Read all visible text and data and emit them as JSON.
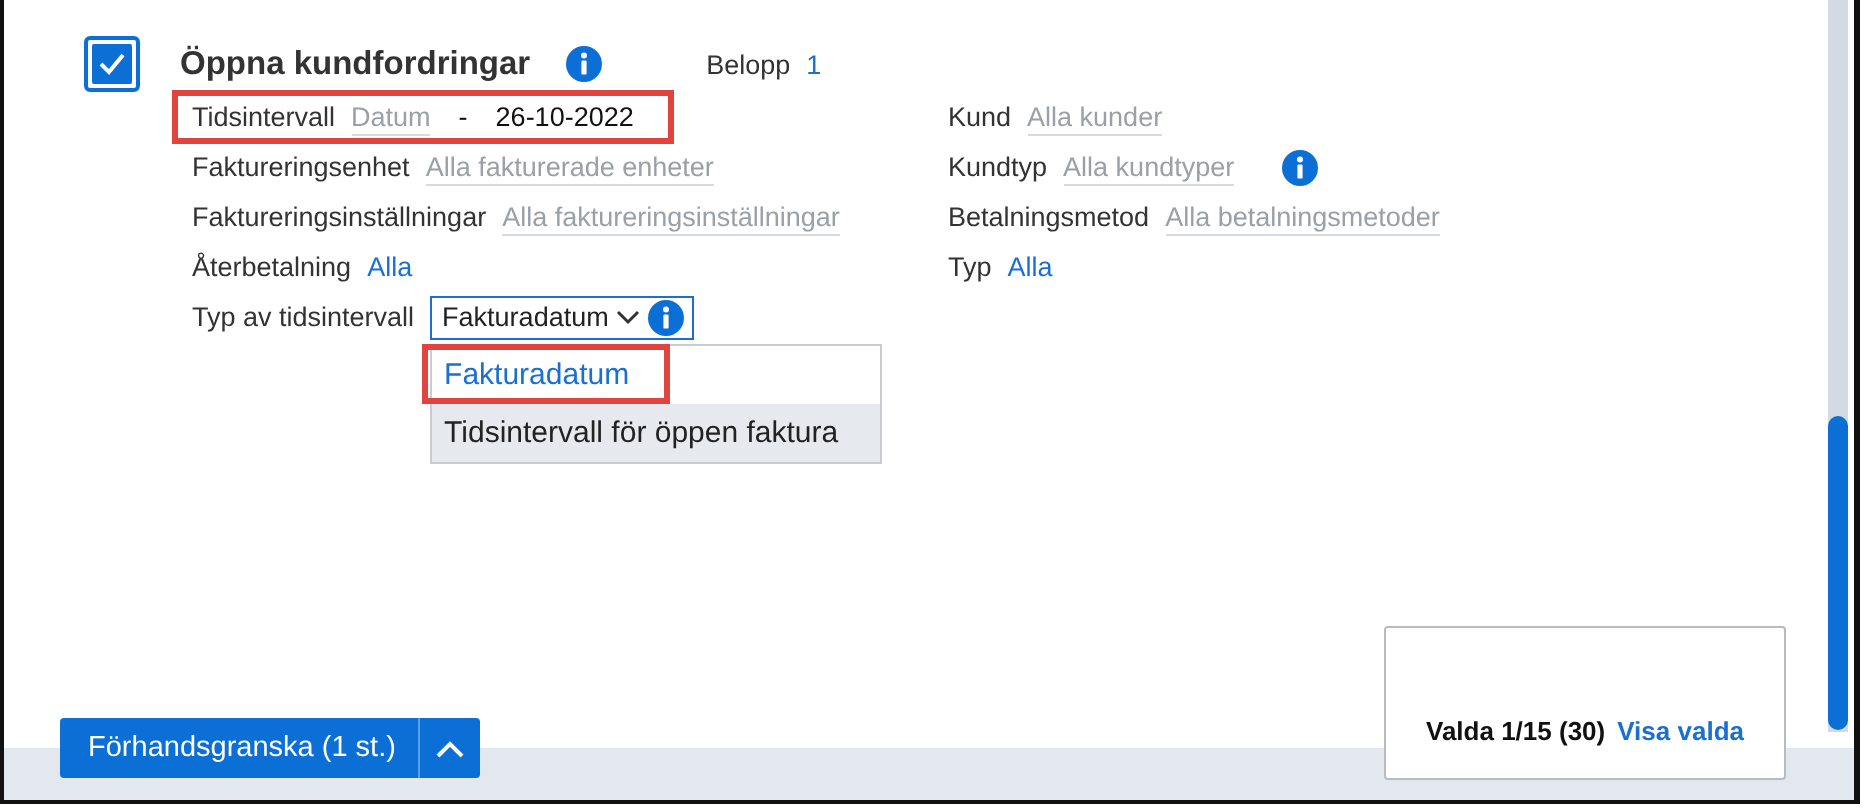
{
  "report": {
    "title": "Öppna kundfordringar",
    "checked": true,
    "amount_label": "Belopp",
    "amount_value": "1"
  },
  "left_filters": [
    {
      "label": "Tidsintervall",
      "kind": "date_range",
      "from_placeholder": "Datum",
      "separator": "-",
      "to_value": "26-10-2022",
      "highlighted": true
    },
    {
      "label": "Faktureringsenhet",
      "kind": "placeholder",
      "value": "Alla fakturerade enheter",
      "highlighted": false
    },
    {
      "label": "Faktureringsinställningar",
      "kind": "placeholder",
      "value": "Alla faktureringsinställningar",
      "highlighted": false
    },
    {
      "label": "Återbetalning",
      "kind": "link",
      "value": "Alla",
      "highlighted": false
    },
    {
      "label": "Typ av tidsintervall",
      "kind": "select",
      "value": "Fakturadatum",
      "expanded": true,
      "highlighted": false
    }
  ],
  "menu_options": [
    {
      "label": "Fakturadatum",
      "selected": true,
      "hovered": false,
      "highlighted": true
    },
    {
      "label": "Tidsintervall för öppen faktura",
      "selected": false,
      "hovered": true,
      "highlighted": false
    }
  ],
  "right_filters": [
    {
      "label": "Kund",
      "kind": "placeholder",
      "value": "Alla kunder",
      "info": false
    },
    {
      "label": "Kundtyp",
      "kind": "placeholder",
      "value": "Alla kundtyper",
      "info": true
    },
    {
      "label": "Betalningsmetod",
      "kind": "placeholder",
      "value": "Alla betalningsmetoder",
      "info": false
    },
    {
      "label": "Typ",
      "kind": "link",
      "value": "Alla",
      "info": false
    }
  ],
  "footer": {
    "preview_button": "Förhandsgranska (1 st.)",
    "selection_text": "Valda 1/15 (30)",
    "selection_link": "Visa valda"
  }
}
